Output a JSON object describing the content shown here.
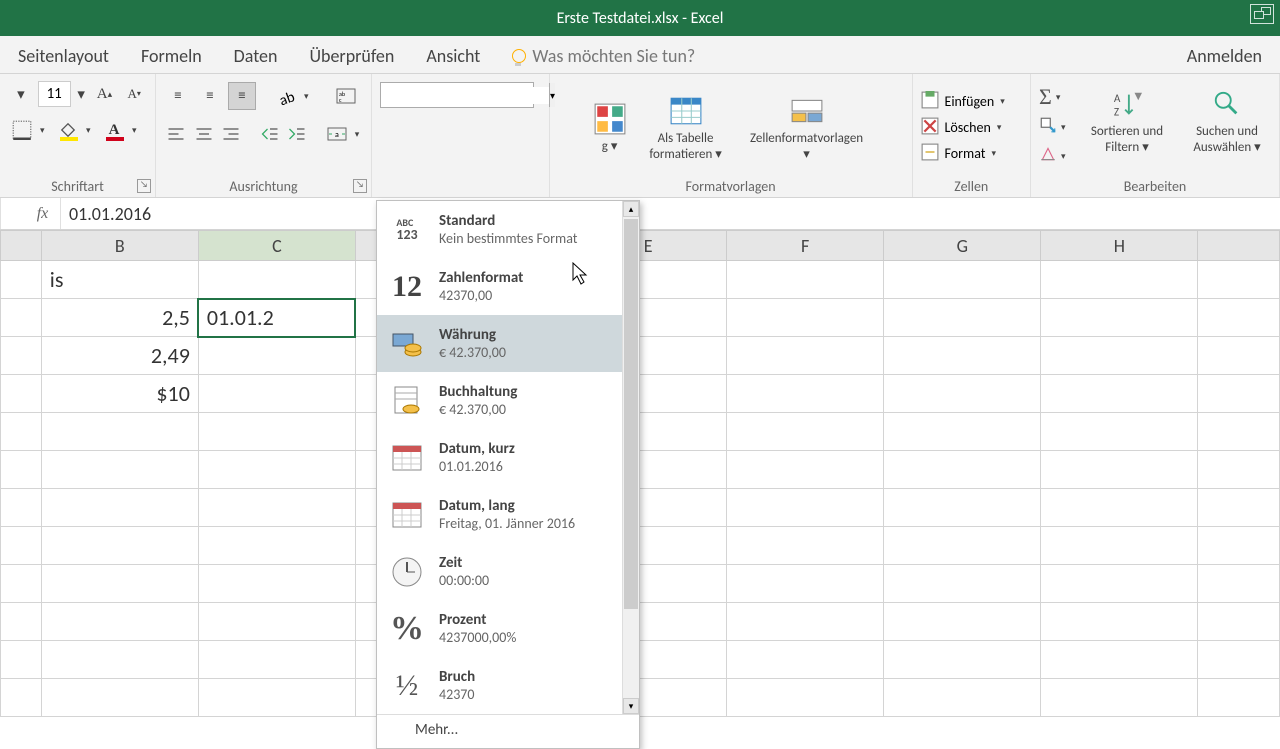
{
  "title": "Erste Testdatei.xlsx - Excel",
  "tabs": {
    "seitenlayout": "Seitenlayout",
    "formeln": "Formeln",
    "daten": "Daten",
    "uberprufen": "Überprüfen",
    "ansicht": "Ansicht",
    "tellme": "Was möchten Sie tun?",
    "anmelden": "Anmelden"
  },
  "ribbon": {
    "schriftart": "Schriftart",
    "fontsize": "11",
    "ausrichtung": "Ausrichtung",
    "formatvorlagen_partial": "g ▾",
    "formatieren": "formatieren ▾",
    "als_tabelle": "Als Tabelle",
    "zellenformatvorlagen": "Zellenformatvorlagen",
    "formatvorlagen_label": "Formatvorlagen",
    "einfugen": "Einfügen",
    "loschen": "Löschen",
    "format": "Format",
    "zellen_label": "Zellen",
    "sortieren": "Sortieren und Filtern ▾",
    "suchen": "Suchen und Auswählen ▾",
    "bearbeiten": "Bearbeiten"
  },
  "formula_value": "01.01.2016",
  "columns": [
    "B",
    "C",
    "",
    "E",
    "F",
    "G",
    "H",
    ""
  ],
  "cells": {
    "b_top": "is",
    "b2": "2,5",
    "b3": "2,49",
    "b4": "$10",
    "c2": "01.01.2"
  },
  "number_formats": [
    {
      "label": "Standard",
      "sample": "Kein bestimmtes Format",
      "icon": "ABC123"
    },
    {
      "label": "Zahlenformat",
      "sample": "42370,00",
      "icon": "12"
    },
    {
      "label": "Währung",
      "sample": "€ 42.370,00",
      "icon": "coins"
    },
    {
      "label": "Buchhaltung",
      "sample": "€ 42.370,00",
      "icon": "ledger"
    },
    {
      "label": "Datum, kurz",
      "sample": "01.01.2016",
      "icon": "cal"
    },
    {
      "label": "Datum, lang",
      "sample": "Freitag, 01. Jänner 2016",
      "icon": "cal"
    },
    {
      "label": "Zeit",
      "sample": "00:00:00",
      "icon": "clock"
    },
    {
      "label": "Prozent",
      "sample": "4237000,00%",
      "icon": "%"
    },
    {
      "label": "Bruch",
      "sample": "42370",
      "icon": "½"
    }
  ],
  "nf_more": "Mehr..."
}
